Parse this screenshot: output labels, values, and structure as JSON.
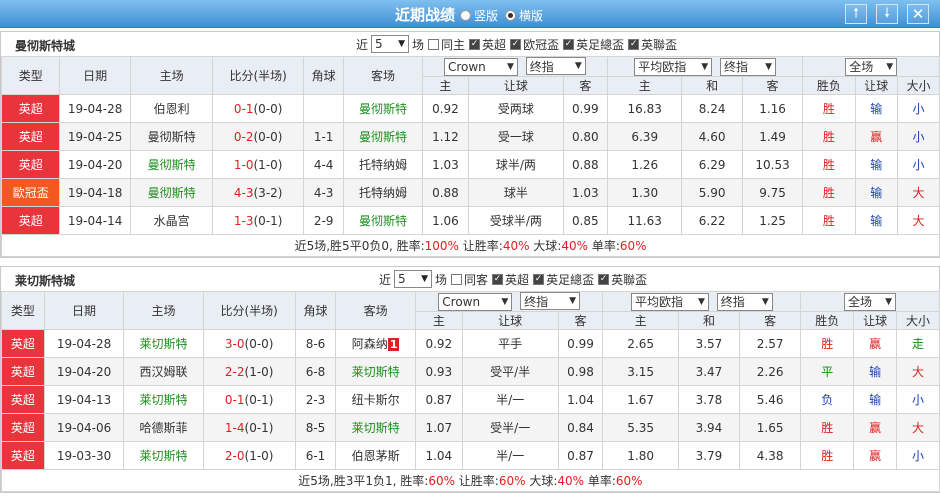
{
  "header": {
    "title": "近期战绩",
    "view_vertical": "竖版",
    "view_horizontal": "横版",
    "up_icon": "arrow-up-icon",
    "down_icon": "arrow-down-icon",
    "close_icon": "close-icon"
  },
  "teams": [
    {
      "name": "曼彻斯特城",
      "recent_label": "近",
      "recent_count": "5",
      "recent_unit": "场",
      "filters": [
        {
          "label": "同主",
          "checked": false
        },
        {
          "label": "英超",
          "checked": true
        },
        {
          "label": "欧冠盃",
          "checked": true
        },
        {
          "label": "英足總盃",
          "checked": true
        },
        {
          "label": "英聯盃",
          "checked": true
        }
      ],
      "columns": {
        "type": "类型",
        "date": "日期",
        "home": "主场",
        "score": "比分(半场)",
        "corner": "角球",
        "away": "客场",
        "company": "Crown",
        "asian_period": "终指",
        "euro_label": "平均欧指",
        "euro_period": "终指",
        "scope": "全场",
        "asian_home": "主",
        "asian_handicap": "让球",
        "asian_away": "客",
        "euro_home": "主",
        "euro_draw": "和",
        "euro_away": "客",
        "result": "胜负",
        "handicap_result": "让球",
        "ou_result": "大小"
      },
      "rows": [
        {
          "league": "英超",
          "league_color": "red",
          "date": "19-04-28",
          "home": "伯恩利",
          "home_hl": false,
          "score": "0-1",
          "half": "(0-0)",
          "corner": "",
          "away": "曼彻斯特",
          "away_hl": true,
          "ah": "0.92",
          "handicap": "受两球",
          "aa": "0.99",
          "eh": "16.83",
          "ed": "8.24",
          "ea": "1.16",
          "res": "胜",
          "res_c": "red",
          "hres": "输",
          "hres_c": "blue",
          "ou": "小",
          "ou_c": "blue"
        },
        {
          "league": "英超",
          "league_color": "red",
          "date": "19-04-25",
          "home": "曼彻斯特",
          "home_hl": false,
          "score": "0-2",
          "half": "(0-0)",
          "corner": "1-1",
          "away": "曼彻斯特",
          "away_hl": true,
          "ah": "1.12",
          "handicap": "受一球",
          "aa": "0.80",
          "eh": "6.39",
          "ed": "4.60",
          "ea": "1.49",
          "res": "胜",
          "res_c": "red",
          "hres": "赢",
          "hres_c": "red",
          "ou": "小",
          "ou_c": "blue"
        },
        {
          "league": "英超",
          "league_color": "red",
          "date": "19-04-20",
          "home": "曼彻斯特",
          "home_hl": true,
          "score": "1-0",
          "half": "(1-0)",
          "corner": "4-4",
          "away": "托特纳姆",
          "away_hl": false,
          "ah": "1.03",
          "handicap": "球半/两",
          "aa": "0.88",
          "eh": "1.26",
          "ed": "6.29",
          "ea": "10.53",
          "res": "胜",
          "res_c": "red",
          "hres": "输",
          "hres_c": "blue",
          "ou": "小",
          "ou_c": "blue"
        },
        {
          "league": "歐冠盃",
          "league_color": "orange",
          "date": "19-04-18",
          "home": "曼彻斯特",
          "home_hl": true,
          "score": "4-3",
          "half": "(3-2)",
          "corner": "4-3",
          "away": "托特纳姆",
          "away_hl": false,
          "ah": "0.88",
          "handicap": "球半",
          "aa": "1.03",
          "eh": "1.30",
          "ed": "5.90",
          "ea": "9.75",
          "res": "胜",
          "res_c": "red",
          "hres": "输",
          "hres_c": "blue",
          "ou": "大",
          "ou_c": "red"
        },
        {
          "league": "英超",
          "league_color": "red",
          "date": "19-04-14",
          "home": "水晶宫",
          "home_hl": false,
          "score": "1-3",
          "half": "(0-1)",
          "corner": "2-9",
          "away": "曼彻斯特",
          "away_hl": true,
          "ah": "1.06",
          "handicap": "受球半/两",
          "aa": "0.85",
          "eh": "11.63",
          "ed": "6.22",
          "ea": "1.25",
          "res": "胜",
          "res_c": "red",
          "hres": "输",
          "hres_c": "blue",
          "ou": "大",
          "ou_c": "red"
        }
      ],
      "summary": {
        "prefix": "近5场,胜5平0负0, 胜率:",
        "win_rate": "100%",
        "p2": " 让胜率:",
        "handicap_rate": "40%",
        "p3": " 大球:",
        "over_rate": "40%",
        "p4": " 单率:",
        "odd_rate": "60%"
      }
    },
    {
      "name": "莱切斯特城",
      "recent_label": "近",
      "recent_count": "5",
      "recent_unit": "场",
      "filters": [
        {
          "label": "同客",
          "checked": false
        },
        {
          "label": "英超",
          "checked": true
        },
        {
          "label": "英足總盃",
          "checked": true
        },
        {
          "label": "英聯盃",
          "checked": true
        }
      ],
      "columns": {
        "type": "类型",
        "date": "日期",
        "home": "主场",
        "score": "比分(半场)",
        "corner": "角球",
        "away": "客场",
        "company": "Crown",
        "asian_period": "终指",
        "euro_label": "平均欧指",
        "euro_period": "终指",
        "scope": "全场",
        "asian_home": "主",
        "asian_handicap": "让球",
        "asian_away": "客",
        "euro_home": "主",
        "euro_draw": "和",
        "euro_away": "客",
        "result": "胜负",
        "handicap_result": "让球",
        "ou_result": "大小"
      },
      "rows": [
        {
          "league": "英超",
          "league_color": "red",
          "date": "19-04-28",
          "home": "莱切斯特",
          "home_hl": true,
          "score": "3-0",
          "half": "(0-0)",
          "corner": "8-6",
          "away": "阿森纳",
          "away_hl": false,
          "away_badge": "1",
          "ah": "0.92",
          "handicap": "平手",
          "aa": "0.99",
          "eh": "2.65",
          "ed": "3.57",
          "ea": "2.57",
          "res": "胜",
          "res_c": "red",
          "hres": "赢",
          "hres_c": "red",
          "ou": "走",
          "ou_c": "green"
        },
        {
          "league": "英超",
          "league_color": "red",
          "date": "19-04-20",
          "home": "西汉姆联",
          "home_hl": false,
          "score": "2-2",
          "half": "(1-0)",
          "corner": "6-8",
          "away": "莱切斯特",
          "away_hl": true,
          "ah": "0.93",
          "handicap": "受平/半",
          "aa": "0.98",
          "eh": "3.15",
          "ed": "3.47",
          "ea": "2.26",
          "res": "平",
          "res_c": "green",
          "hres": "输",
          "hres_c": "blue",
          "ou": "大",
          "ou_c": "red"
        },
        {
          "league": "英超",
          "league_color": "red",
          "date": "19-04-13",
          "home": "莱切斯特",
          "home_hl": true,
          "score": "0-1",
          "half": "(0-1)",
          "corner": "2-3",
          "away": "纽卡斯尔",
          "away_hl": false,
          "ah": "0.87",
          "handicap": "半/一",
          "aa": "1.04",
          "eh": "1.67",
          "ed": "3.78",
          "ea": "5.46",
          "res": "负",
          "res_c": "blue",
          "hres": "输",
          "hres_c": "blue",
          "ou": "小",
          "ou_c": "blue"
        },
        {
          "league": "英超",
          "league_color": "red",
          "date": "19-04-06",
          "home": "哈德斯菲",
          "home_hl": false,
          "score": "1-4",
          "half": "(0-1)",
          "corner": "8-5",
          "away": "莱切斯特",
          "away_hl": true,
          "ah": "1.07",
          "handicap": "受半/一",
          "aa": "0.84",
          "eh": "5.35",
          "ed": "3.94",
          "ea": "1.65",
          "res": "胜",
          "res_c": "red",
          "hres": "赢",
          "hres_c": "red",
          "ou": "大",
          "ou_c": "red"
        },
        {
          "league": "英超",
          "league_color": "red",
          "date": "19-03-30",
          "home": "莱切斯特",
          "home_hl": true,
          "score": "2-0",
          "half": "(1-0)",
          "corner": "6-1",
          "away": "伯恩茅斯",
          "away_hl": false,
          "ah": "1.04",
          "handicap": "半/一",
          "aa": "0.87",
          "eh": "1.80",
          "ed": "3.79",
          "ea": "4.38",
          "res": "胜",
          "res_c": "red",
          "hres": "赢",
          "hres_c": "red",
          "ou": "小",
          "ou_c": "blue"
        }
      ],
      "summary": {
        "prefix": "近5场,胜3平1负1, 胜率:",
        "win_rate": "60%",
        "p2": " 让胜率:",
        "handicap_rate": "60%",
        "p3": " 大球:",
        "over_rate": "40%",
        "p4": " 单率:",
        "odd_rate": "60%"
      }
    }
  ]
}
